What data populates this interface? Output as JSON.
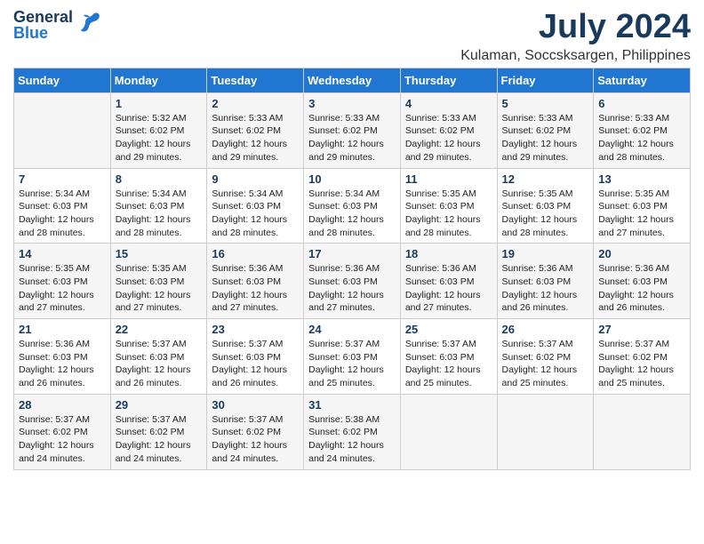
{
  "logo": {
    "general": "General",
    "blue": "Blue"
  },
  "title": "July 2024",
  "subtitle": "Kulaman, Soccsksargen, Philippines",
  "days_of_week": [
    "Sunday",
    "Monday",
    "Tuesday",
    "Wednesday",
    "Thursday",
    "Friday",
    "Saturday"
  ],
  "weeks": [
    [
      {
        "day": "",
        "info": ""
      },
      {
        "day": "1",
        "info": "Sunrise: 5:32 AM\nSunset: 6:02 PM\nDaylight: 12 hours\nand 29 minutes."
      },
      {
        "day": "2",
        "info": "Sunrise: 5:33 AM\nSunset: 6:02 PM\nDaylight: 12 hours\nand 29 minutes."
      },
      {
        "day": "3",
        "info": "Sunrise: 5:33 AM\nSunset: 6:02 PM\nDaylight: 12 hours\nand 29 minutes."
      },
      {
        "day": "4",
        "info": "Sunrise: 5:33 AM\nSunset: 6:02 PM\nDaylight: 12 hours\nand 29 minutes."
      },
      {
        "day": "5",
        "info": "Sunrise: 5:33 AM\nSunset: 6:02 PM\nDaylight: 12 hours\nand 29 minutes."
      },
      {
        "day": "6",
        "info": "Sunrise: 5:33 AM\nSunset: 6:02 PM\nDaylight: 12 hours\nand 28 minutes."
      }
    ],
    [
      {
        "day": "7",
        "info": "Sunrise: 5:34 AM\nSunset: 6:03 PM\nDaylight: 12 hours\nand 28 minutes."
      },
      {
        "day": "8",
        "info": "Sunrise: 5:34 AM\nSunset: 6:03 PM\nDaylight: 12 hours\nand 28 minutes."
      },
      {
        "day": "9",
        "info": "Sunrise: 5:34 AM\nSunset: 6:03 PM\nDaylight: 12 hours\nand 28 minutes."
      },
      {
        "day": "10",
        "info": "Sunrise: 5:34 AM\nSunset: 6:03 PM\nDaylight: 12 hours\nand 28 minutes."
      },
      {
        "day": "11",
        "info": "Sunrise: 5:35 AM\nSunset: 6:03 PM\nDaylight: 12 hours\nand 28 minutes."
      },
      {
        "day": "12",
        "info": "Sunrise: 5:35 AM\nSunset: 6:03 PM\nDaylight: 12 hours\nand 28 minutes."
      },
      {
        "day": "13",
        "info": "Sunrise: 5:35 AM\nSunset: 6:03 PM\nDaylight: 12 hours\nand 27 minutes."
      }
    ],
    [
      {
        "day": "14",
        "info": "Sunrise: 5:35 AM\nSunset: 6:03 PM\nDaylight: 12 hours\nand 27 minutes."
      },
      {
        "day": "15",
        "info": "Sunrise: 5:35 AM\nSunset: 6:03 PM\nDaylight: 12 hours\nand 27 minutes."
      },
      {
        "day": "16",
        "info": "Sunrise: 5:36 AM\nSunset: 6:03 PM\nDaylight: 12 hours\nand 27 minutes."
      },
      {
        "day": "17",
        "info": "Sunrise: 5:36 AM\nSunset: 6:03 PM\nDaylight: 12 hours\nand 27 minutes."
      },
      {
        "day": "18",
        "info": "Sunrise: 5:36 AM\nSunset: 6:03 PM\nDaylight: 12 hours\nand 27 minutes."
      },
      {
        "day": "19",
        "info": "Sunrise: 5:36 AM\nSunset: 6:03 PM\nDaylight: 12 hours\nand 26 minutes."
      },
      {
        "day": "20",
        "info": "Sunrise: 5:36 AM\nSunset: 6:03 PM\nDaylight: 12 hours\nand 26 minutes."
      }
    ],
    [
      {
        "day": "21",
        "info": "Sunrise: 5:36 AM\nSunset: 6:03 PM\nDaylight: 12 hours\nand 26 minutes."
      },
      {
        "day": "22",
        "info": "Sunrise: 5:37 AM\nSunset: 6:03 PM\nDaylight: 12 hours\nand 26 minutes."
      },
      {
        "day": "23",
        "info": "Sunrise: 5:37 AM\nSunset: 6:03 PM\nDaylight: 12 hours\nand 26 minutes."
      },
      {
        "day": "24",
        "info": "Sunrise: 5:37 AM\nSunset: 6:03 PM\nDaylight: 12 hours\nand 25 minutes."
      },
      {
        "day": "25",
        "info": "Sunrise: 5:37 AM\nSunset: 6:03 PM\nDaylight: 12 hours\nand 25 minutes."
      },
      {
        "day": "26",
        "info": "Sunrise: 5:37 AM\nSunset: 6:02 PM\nDaylight: 12 hours\nand 25 minutes."
      },
      {
        "day": "27",
        "info": "Sunrise: 5:37 AM\nSunset: 6:02 PM\nDaylight: 12 hours\nand 25 minutes."
      }
    ],
    [
      {
        "day": "28",
        "info": "Sunrise: 5:37 AM\nSunset: 6:02 PM\nDaylight: 12 hours\nand 24 minutes."
      },
      {
        "day": "29",
        "info": "Sunrise: 5:37 AM\nSunset: 6:02 PM\nDaylight: 12 hours\nand 24 minutes."
      },
      {
        "day": "30",
        "info": "Sunrise: 5:37 AM\nSunset: 6:02 PM\nDaylight: 12 hours\nand 24 minutes."
      },
      {
        "day": "31",
        "info": "Sunrise: 5:38 AM\nSunset: 6:02 PM\nDaylight: 12 hours\nand 24 minutes."
      },
      {
        "day": "",
        "info": ""
      },
      {
        "day": "",
        "info": ""
      },
      {
        "day": "",
        "info": ""
      }
    ]
  ]
}
